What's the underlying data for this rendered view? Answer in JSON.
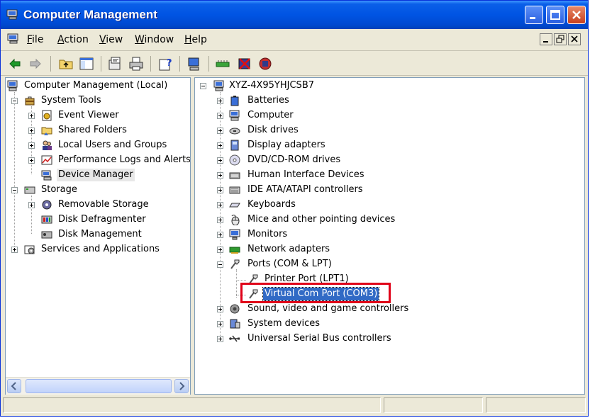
{
  "window": {
    "title": "Computer Management",
    "title_icon": "computer-management-icon",
    "colors": {
      "titlebar": "#0054e3",
      "selection": "#316ac5",
      "highlight_box": "#e00018"
    }
  },
  "menu": [
    {
      "label": "File",
      "accel": "F",
      "rest": "ile"
    },
    {
      "label": "Action",
      "accel": "A",
      "rest": "ction"
    },
    {
      "label": "View",
      "accel": "V",
      "rest": "iew"
    },
    {
      "label": "Window",
      "accel": "W",
      "rest": "indow"
    },
    {
      "label": "Help",
      "accel": "H",
      "rest": "elp"
    }
  ],
  "toolbar": {
    "icons": [
      "back-arrow-icon",
      "forward-arrow-icon",
      "up-folder-icon",
      "show-hide-tree-icon",
      "properties-icon",
      "print-icon",
      "help-icon",
      "scan-hardware-icon",
      "update-driver-icon",
      "disable-device-icon",
      "uninstall-device-icon"
    ]
  },
  "left_tree": [
    {
      "label": "Computer Management (Local)",
      "icon": "computer-management-icon"
    },
    {
      "label": "System Tools",
      "icon": "toolbox-icon"
    },
    {
      "label": "Event Viewer",
      "icon": "event-viewer-icon"
    },
    {
      "label": "Shared Folders",
      "icon": "shared-folder-icon"
    },
    {
      "label": "Local Users and Groups",
      "icon": "users-icon"
    },
    {
      "label": "Performance Logs and Alerts",
      "icon": "performance-icon"
    },
    {
      "label": "Device Manager",
      "icon": "device-manager-icon"
    },
    {
      "label": "Storage",
      "icon": "storage-icon"
    },
    {
      "label": "Removable Storage",
      "icon": "removable-storage-icon"
    },
    {
      "label": "Disk Defragmenter",
      "icon": "defrag-icon"
    },
    {
      "label": "Disk Management",
      "icon": "disk-management-icon"
    },
    {
      "label": "Services and Applications",
      "icon": "services-icon"
    }
  ],
  "right_tree": {
    "root": "XYZ-4X95YHJCSB7",
    "categories": [
      {
        "label": "Batteries",
        "icon": "battery-icon"
      },
      {
        "label": "Computer",
        "icon": "computer-icon"
      },
      {
        "label": "Disk drives",
        "icon": "disk-drive-icon"
      },
      {
        "label": "Display adapters",
        "icon": "display-adapter-icon"
      },
      {
        "label": "DVD/CD-ROM drives",
        "icon": "cdrom-icon"
      },
      {
        "label": "Human Interface Devices",
        "icon": "hid-icon"
      },
      {
        "label": "IDE ATA/ATAPI controllers",
        "icon": "ide-controller-icon"
      },
      {
        "label": "Keyboards",
        "icon": "keyboard-icon"
      },
      {
        "label": "Mice and other pointing devices",
        "icon": "mouse-icon"
      },
      {
        "label": "Monitors",
        "icon": "monitor-icon"
      },
      {
        "label": "Network adapters",
        "icon": "network-adapter-icon"
      },
      {
        "label": "Ports (COM & LPT)",
        "icon": "port-icon"
      },
      {
        "label": "Printer Port (LPT1)",
        "icon": "port-icon"
      },
      {
        "label": "Virtual Com Port (COM3)",
        "icon": "port-icon"
      },
      {
        "label": "Sound, video and game controllers",
        "icon": "sound-icon"
      },
      {
        "label": "System devices",
        "icon": "system-device-icon"
      },
      {
        "label": "Universal Serial Bus controllers",
        "icon": "usb-icon"
      }
    ]
  }
}
